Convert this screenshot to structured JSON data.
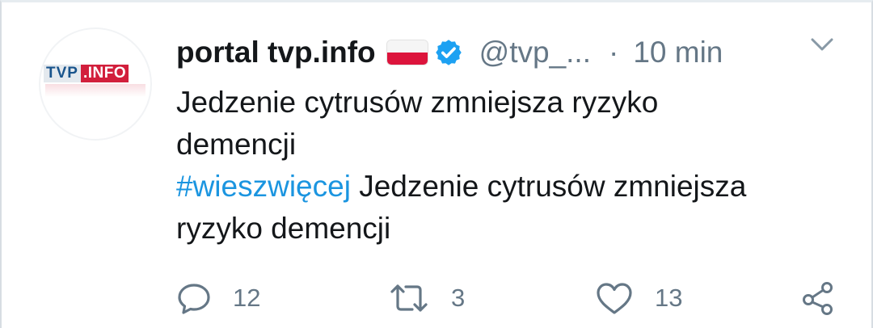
{
  "tweet": {
    "avatar": {
      "logo_part_a": "TVP",
      "logo_part_b": ".INFO"
    },
    "author": {
      "name": "portal tvp.info",
      "handle": "@tvp_...",
      "time_separator": "·",
      "time": "10 min"
    },
    "text": {
      "line1": "Jedzenie cytrusów zmniejsza ryzyko",
      "line2": "demencji",
      "hashtag": "#wieszwięcej",
      "line3_rest": " Jedzenie cytrusów zmniejsza",
      "line4": "ryzyko demencji"
    },
    "actions": {
      "reply_count": "12",
      "retweet_count": "3",
      "like_count": "13"
    }
  },
  "icons": {
    "flag": "poland-flag-icon",
    "verified": "verified-badge-icon",
    "menu": "chevron-down-icon",
    "reply": "reply-icon",
    "retweet": "retweet-icon",
    "like": "heart-icon",
    "share": "share-icon"
  },
  "colors": {
    "text": "#14171a",
    "secondary": "#657786",
    "link": "#1b95e0",
    "verified": "#1da1f2",
    "flag_red": "#dc143c",
    "logo_red": "#d21f3c",
    "logo_blue": "#19548c"
  }
}
